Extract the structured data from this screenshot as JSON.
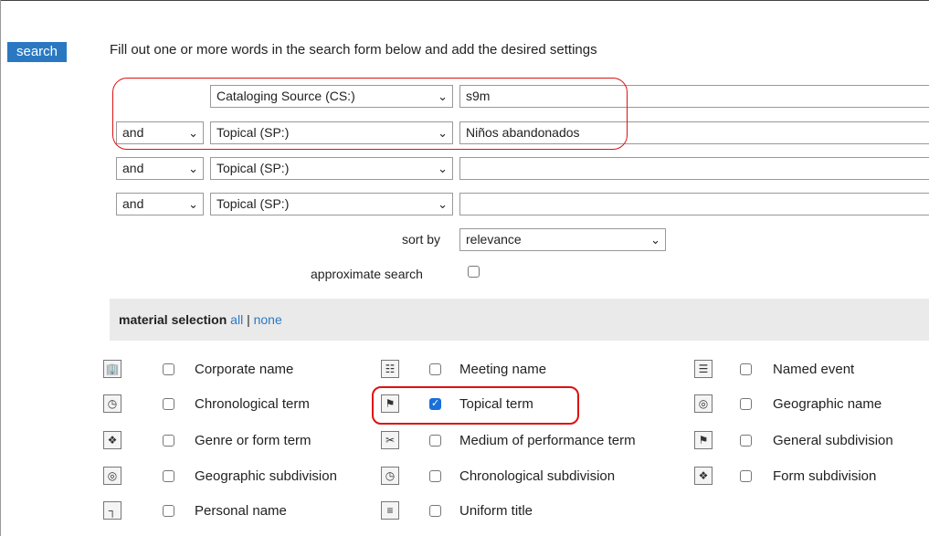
{
  "search_tab": "search",
  "intro_text": "Fill out one or more words in the search form below and add the desired settings",
  "rows": [
    {
      "op": "",
      "field": "Cataloging Source (CS:)",
      "value": "s9m"
    },
    {
      "op": "and",
      "field": "Topical (SP:)",
      "value": "Niños abandonados"
    },
    {
      "op": "and",
      "field": "Topical (SP:)",
      "value": ""
    },
    {
      "op": "and",
      "field": "Topical (SP:)",
      "value": ""
    }
  ],
  "sort": {
    "label": "sort by",
    "value": "relevance"
  },
  "approx": {
    "label": "approximate search",
    "checked": false
  },
  "material": {
    "title": "material selection",
    "all": "all",
    "sep": "|",
    "none": "none",
    "items": [
      {
        "label": "Corporate name",
        "icon": "corporate-name-icon",
        "checked": false
      },
      {
        "label": "Meeting name",
        "icon": "meeting-name-icon",
        "checked": false
      },
      {
        "label": "Named event",
        "icon": "named-event-icon",
        "checked": false
      },
      {
        "label": "Chronological term",
        "icon": "clock-icon",
        "checked": false
      },
      {
        "label": "Topical term",
        "icon": "topical-term-icon",
        "checked": true
      },
      {
        "label": "Geographic name",
        "icon": "globe-icon",
        "checked": false
      },
      {
        "label": "Genre or form term",
        "icon": "genre-icon",
        "checked": false
      },
      {
        "label": "Medium of performance term",
        "icon": "instrument-icon",
        "checked": false
      },
      {
        "label": "General subdivision",
        "icon": "topical-term-icon",
        "checked": false
      },
      {
        "label": "Geographic subdivision",
        "icon": "globe-icon",
        "checked": false
      },
      {
        "label": "Chronological subdivision",
        "icon": "clock-icon",
        "checked": false
      },
      {
        "label": "Form subdivision",
        "icon": "genre-icon",
        "checked": false
      },
      {
        "label": "Personal name",
        "icon": "person-icon",
        "checked": false
      },
      {
        "label": "Uniform title",
        "icon": "book-icon",
        "checked": false
      }
    ]
  },
  "colors": {
    "accent": "#2a78c2",
    "highlight": "#dd1111"
  }
}
